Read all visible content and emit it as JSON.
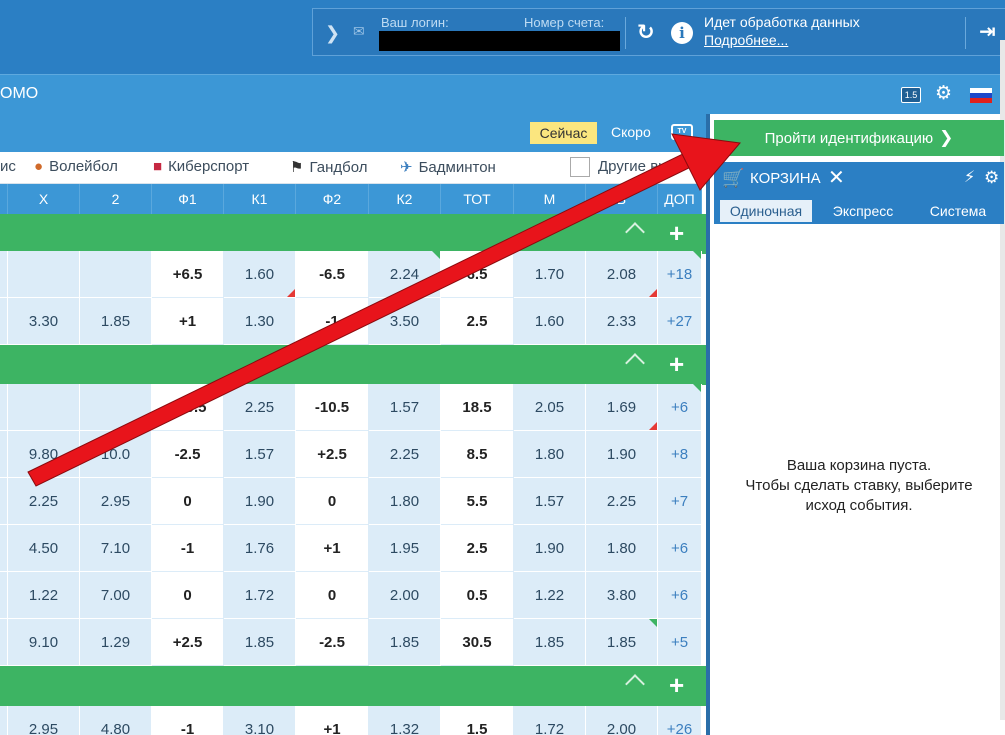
{
  "header": {
    "login_label": "Ваш логин:",
    "account_label": "Номер счета:",
    "status_text": "Идет обработка данных",
    "status_link": "Подробнее..."
  },
  "nav": {
    "promo": "ОМО",
    "version_badge": "1.5"
  },
  "toolbar": {
    "now_tab": "Сейчас",
    "soon_tab": "Скоро",
    "tv_label": "TV"
  },
  "sports": [
    {
      "label": "ис",
      "icon": ""
    },
    {
      "label": "Волейбол",
      "icon": "volleyball-icon"
    },
    {
      "label": "Киберспорт",
      "icon": "gamepad-icon"
    },
    {
      "label": "Гандбол",
      "icon": "handball-icon"
    },
    {
      "label": "Бадминтон",
      "icon": "badminton-icon"
    },
    {
      "label": "Другие ви",
      "icon": "checkbox"
    }
  ],
  "columns": [
    "X",
    "2",
    "Ф1",
    "К1",
    "Ф2",
    "К2",
    "ТОТ",
    "М",
    "Б",
    "ДОП"
  ],
  "rows": [
    {
      "cells": [
        "",
        "",
        "+6.5",
        "1.60",
        "-6.5",
        "2.24",
        "6.5",
        "1.70",
        "2.08",
        "+18"
      ]
    },
    {
      "cells": [
        "3.30",
        "1.85",
        "+1",
        "1.30",
        "-1",
        "3.50",
        "2.5",
        "1.60",
        "2.33",
        "+27"
      ]
    },
    {
      "cells": [
        "",
        "",
        "+10.5",
        "2.25",
        "-10.5",
        "1.57",
        "18.5",
        "2.05",
        "1.69",
        "+6"
      ]
    },
    {
      "cells": [
        "9.80",
        "10.0",
        "-2.5",
        "1.57",
        "+2.5",
        "2.25",
        "8.5",
        "1.80",
        "1.90",
        "+8"
      ]
    },
    {
      "cells": [
        "2.25",
        "2.95",
        "0",
        "1.90",
        "0",
        "1.80",
        "5.5",
        "1.57",
        "2.25",
        "+7"
      ]
    },
    {
      "cells": [
        "4.50",
        "7.10",
        "-1",
        "1.76",
        "+1",
        "1.95",
        "2.5",
        "1.90",
        "1.80",
        "+6"
      ]
    },
    {
      "cells": [
        "1.22",
        "7.00",
        "0",
        "1.72",
        "0",
        "2.00",
        "0.5",
        "1.22",
        "3.80",
        "+6"
      ]
    },
    {
      "cells": [
        "9.10",
        "1.29",
        "+2.5",
        "1.85",
        "-2.5",
        "1.85",
        "30.5",
        "1.85",
        "1.85",
        "+5"
      ]
    },
    {
      "cells": [
        "2.95",
        "4.80",
        "-1",
        "3.10",
        "+1",
        "1.32",
        "1.5",
        "1.72",
        "2.00",
        "+26"
      ]
    }
  ],
  "right_panel": {
    "ident_button": "Пройти идентификацию",
    "cart_title": "КОРЗИНА",
    "tabs": [
      "Одиночная",
      "Экспресс",
      "Система"
    ],
    "empty_line1": "Ваша корзина пуста.",
    "empty_line2": "Чтобы сделать ставку, выберите",
    "empty_line3": "исход события."
  },
  "colors": {
    "header_blue": "#2b7fc4",
    "nav_blue": "#3c97d6",
    "green": "#3db463",
    "cell_light": "#dcecf8",
    "arrow_red": "#e8141b",
    "now_yellow": "#fbe67f"
  }
}
